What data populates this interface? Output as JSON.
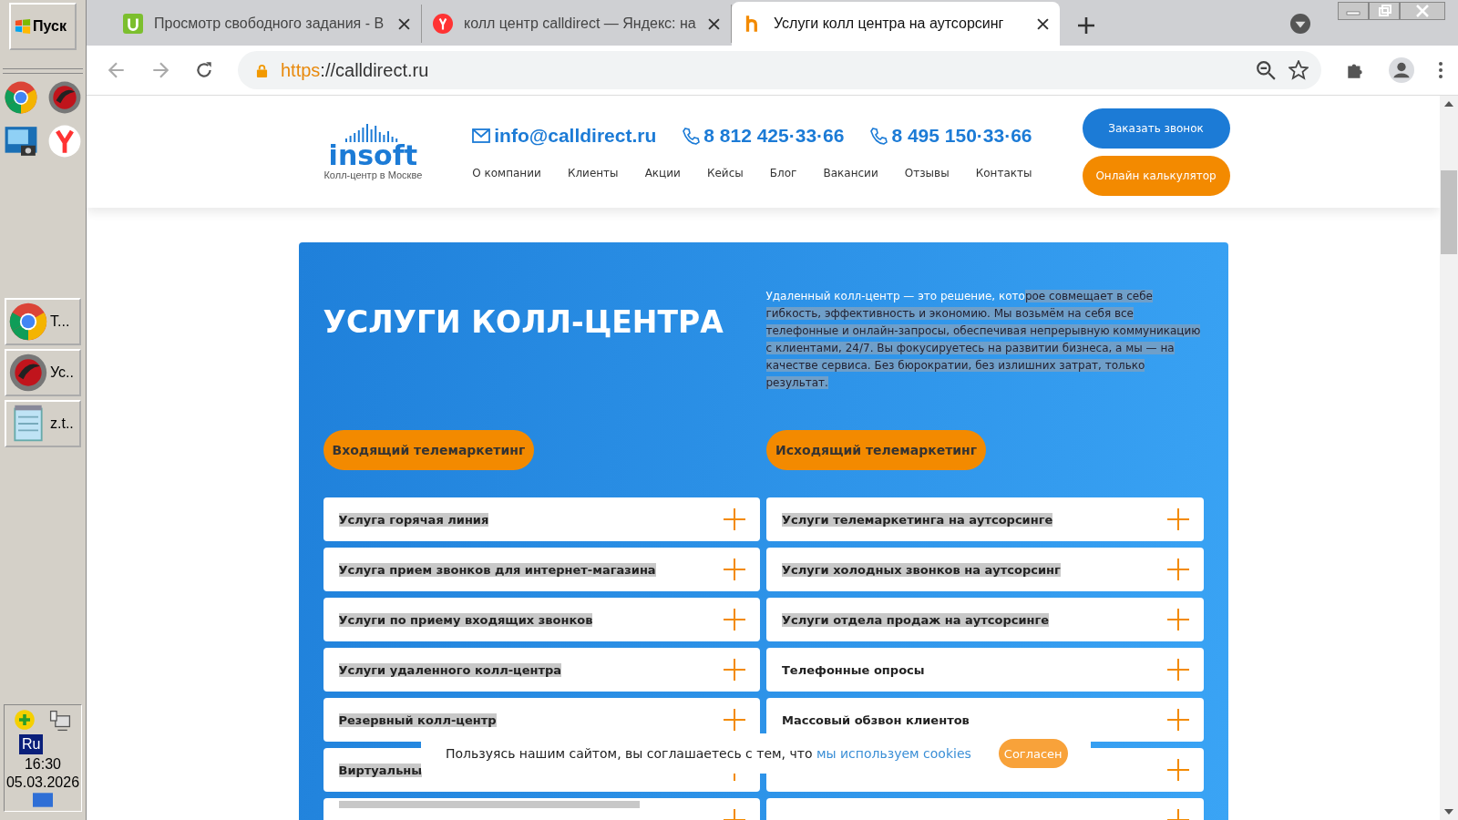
{
  "taskbar": {
    "start": "Пуск",
    "windows": [
      {
        "kind": "chrome",
        "label": "T..."
      },
      {
        "kind": "comodo",
        "label": "Ус.."
      },
      {
        "kind": "notepad",
        "label": "z.t.."
      }
    ],
    "language": "Ru",
    "time": "16:30",
    "date": "05.03.2026"
  },
  "browser": {
    "tabs": [
      {
        "kind": "u",
        "title": "Просмотр свободного задания - В",
        "selected": false
      },
      {
        "kind": "yandex",
        "title": "колл центр calldirect — Яндекс: на",
        "selected": false
      },
      {
        "kind": "insoft",
        "title": "Услуги колл центра на аутсорсинг",
        "selected": true
      }
    ],
    "url_scheme": "https",
    "url_rest": "://calldirect.ru"
  },
  "site": {
    "logo": "insoft",
    "tagline": "Колл-центр в Москве",
    "email": "info@calldirect.ru",
    "phones": [
      "8 812 425·33·66",
      "8 495 150·33·66"
    ],
    "nav": [
      "О компании",
      "Клиенты",
      "Акции",
      "Кейсы",
      "Блог",
      "Вакансии",
      "Отзывы",
      "Контакты"
    ],
    "buttons": [
      {
        "kind": "primary",
        "label": "Заказать звонок"
      },
      {
        "kind": "accent",
        "label": "Онлайн калькулятор"
      }
    ]
  },
  "hero": {
    "title": "УСЛУГИ КОЛЛ-ЦЕНТРА",
    "text_plain": "Удаленный колл-центр — это решение, кото",
    "text_highlighted": "рое совмещает в себе гибкость, эффективность и экономию. Мы возьмём на себя все телефонные и онлайн-запросы, обеспечивая непрерывную коммуникацию с клиентами, 24/7. Вы фокусируетесь на развитии бизнеса, а мы — на качестве сервиса. Без бюрократии, без излишних затрат, только результат.",
    "columns": [
      {
        "heading": "Входящий телемаркетинг",
        "items": [
          {
            "label": "Услуга горячая линия",
            "highlighted": true
          },
          {
            "label": "Услуга прием звонков для интернет-магазина",
            "highlighted": true
          },
          {
            "label": "Услуги по приему входящих звонков",
            "highlighted": true
          },
          {
            "label": "Услуги удаленного колл-центра",
            "highlighted": true
          },
          {
            "label": "Резервный колл-центр",
            "highlighted": true
          },
          {
            "label": "Виртуальны",
            "highlighted": true
          },
          {
            "highlighted": true
          }
        ]
      },
      {
        "heading": "Исходящий телемаркетинг",
        "items": [
          {
            "label": "Услуги телемаркетинга на аутсорсинге",
            "highlighted": true
          },
          {
            "label": "Услуги холодных звонков на аутсорсинг",
            "highlighted": true
          },
          {
            "label": "Услуги отдела продаж на аутсорсинге",
            "highlighted": true
          },
          {
            "label": "Телефонные опросы",
            "highlighted": false
          },
          {
            "label": "Массовый обзвон клиентов",
            "highlighted": false
          },
          {
            "highlighted": false
          },
          {
            "highlighted": false
          }
        ]
      }
    ]
  },
  "cookie": {
    "text": "Пользуясь нашим сайтом, вы соглашаетесь с тем, что",
    "link": "мы используем cookies",
    "button": "Согласен"
  }
}
